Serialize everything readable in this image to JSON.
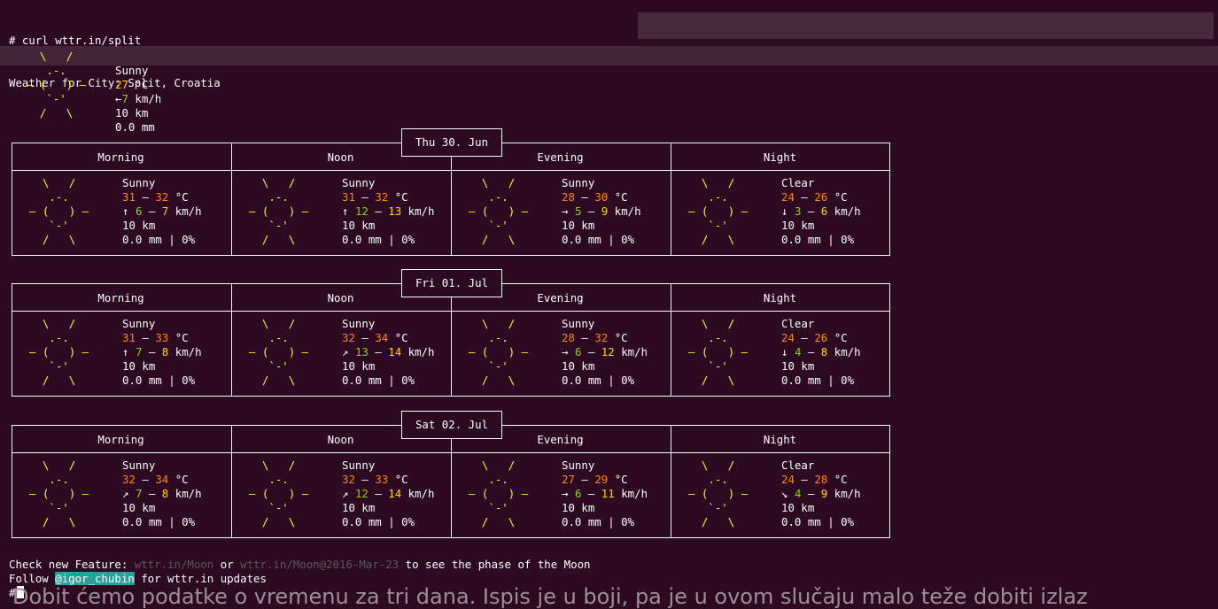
{
  "terminal": {
    "command": "# curl wttr.in/split",
    "location_line": "Weather for City: Split, Croatia"
  },
  "current": {
    "ascii": [
      "  \\   /  ",
      "   .-.   ",
      "― (   ) ―",
      "   `-'   ",
      "  /   \\  "
    ],
    "condition": "Sunny",
    "temp": "27",
    "temp_unit": "°C",
    "wind_arrow": "←",
    "wind_speed": "7",
    "wind_unit": "km/h",
    "visibility": "10 km",
    "precip": "0.0 mm"
  },
  "days": [
    {
      "date": "Thu 30. Jun",
      "periods": [
        {
          "name": "Morning",
          "condition": "Sunny",
          "t1": "31",
          "t2": "32",
          "unit": "°C",
          "arrow": "↑",
          "w1": "6",
          "w2": "7",
          "wunit": "km/h",
          "vis": "10 km",
          "precip": "0.0 mm | 0%"
        },
        {
          "name": "Noon",
          "condition": "Sunny",
          "t1": "31",
          "t2": "32",
          "unit": "°C",
          "arrow": "↑",
          "w1": "12",
          "w2": "13",
          "wunit": "km/h",
          "vis": "10 km",
          "precip": "0.0 mm | 0%"
        },
        {
          "name": "Evening",
          "condition": "Sunny",
          "t1": "28",
          "t2": "30",
          "unit": "°C",
          "arrow": "→",
          "w1": "5",
          "w2": "9",
          "wunit": "km/h",
          "vis": "10 km",
          "precip": "0.0 mm | 0%"
        },
        {
          "name": "Night",
          "condition": "Clear",
          "t1": "24",
          "t2": "26",
          "unit": "°C",
          "arrow": "↓",
          "w1": "3",
          "w2": "6",
          "wunit": "km/h",
          "vis": "10 km",
          "precip": "0.0 mm | 0%"
        }
      ]
    },
    {
      "date": "Fri 01. Jul",
      "periods": [
        {
          "name": "Morning",
          "condition": "Sunny",
          "t1": "31",
          "t2": "33",
          "unit": "°C",
          "arrow": "↑",
          "w1": "7",
          "w2": "8",
          "wunit": "km/h",
          "vis": "10 km",
          "precip": "0.0 mm | 0%"
        },
        {
          "name": "Noon",
          "condition": "Sunny",
          "t1": "32",
          "t2": "34",
          "unit": "°C",
          "arrow": "↗",
          "w1": "13",
          "w2": "14",
          "wunit": "km/h",
          "vis": "10 km",
          "precip": "0.0 mm | 0%"
        },
        {
          "name": "Evening",
          "condition": "Sunny",
          "t1": "28",
          "t2": "32",
          "unit": "°C",
          "arrow": "→",
          "w1": "6",
          "w2": "12",
          "wunit": "km/h",
          "vis": "10 km",
          "precip": "0.0 mm | 0%"
        },
        {
          "name": "Night",
          "condition": "Clear",
          "t1": "24",
          "t2": "26",
          "unit": "°C",
          "arrow": "↓",
          "w1": "4",
          "w2": "8",
          "wunit": "km/h",
          "vis": "10 km",
          "precip": "0.0 mm | 0%"
        }
      ]
    },
    {
      "date": "Sat 02. Jul",
      "periods": [
        {
          "name": "Morning",
          "condition": "Sunny",
          "t1": "32",
          "t2": "34",
          "unit": "°C",
          "arrow": "↗",
          "w1": "7",
          "w2": "8",
          "wunit": "km/h",
          "vis": "10 km",
          "precip": "0.0 mm | 0%"
        },
        {
          "name": "Noon",
          "condition": "Sunny",
          "t1": "32",
          "t2": "33",
          "unit": "°C",
          "arrow": "↗",
          "w1": "12",
          "w2": "14",
          "wunit": "km/h",
          "vis": "10 km",
          "precip": "0.0 mm | 0%"
        },
        {
          "name": "Evening",
          "condition": "Sunny",
          "t1": "27",
          "t2": "29",
          "unit": "°C",
          "arrow": "→",
          "w1": "6",
          "w2": "11",
          "wunit": "km/h",
          "vis": "10 km",
          "precip": "0.0 mm | 0%"
        },
        {
          "name": "Night",
          "condition": "Clear",
          "t1": "24",
          "t2": "28",
          "unit": "°C",
          "arrow": "↘",
          "w1": "4",
          "w2": "9",
          "wunit": "km/h",
          "vis": "10 km",
          "precip": "0.0 mm | 0%"
        }
      ]
    }
  ],
  "footer": {
    "check_prefix": "Check new Feature: ",
    "moon_link": "wttr.in/Moon",
    "or": " or ",
    "moon_date_link": "wttr.in/Moon@2016-Mar-23",
    "check_suffix": " to see the phase of the Moon",
    "follow_prefix": "Follow ",
    "handle": "@igor_chubin",
    "follow_suffix": " for wttr.in updates",
    "prompt": "#"
  },
  "caption": "Dobit ćemo podatke o vremenu za tri dana. Ispis je u boji, pa je u ovom slučaju malo teže dobiti izlaz",
  "colors": {
    "background": "#2d0922",
    "sun_yellow": "#ffff00",
    "temp_orange": "#ff8700",
    "temp_yellow": "#ffd700",
    "wind_green": "#87d700",
    "link_gray": "#5a5a5a",
    "highlight_teal": "#2aa198"
  }
}
